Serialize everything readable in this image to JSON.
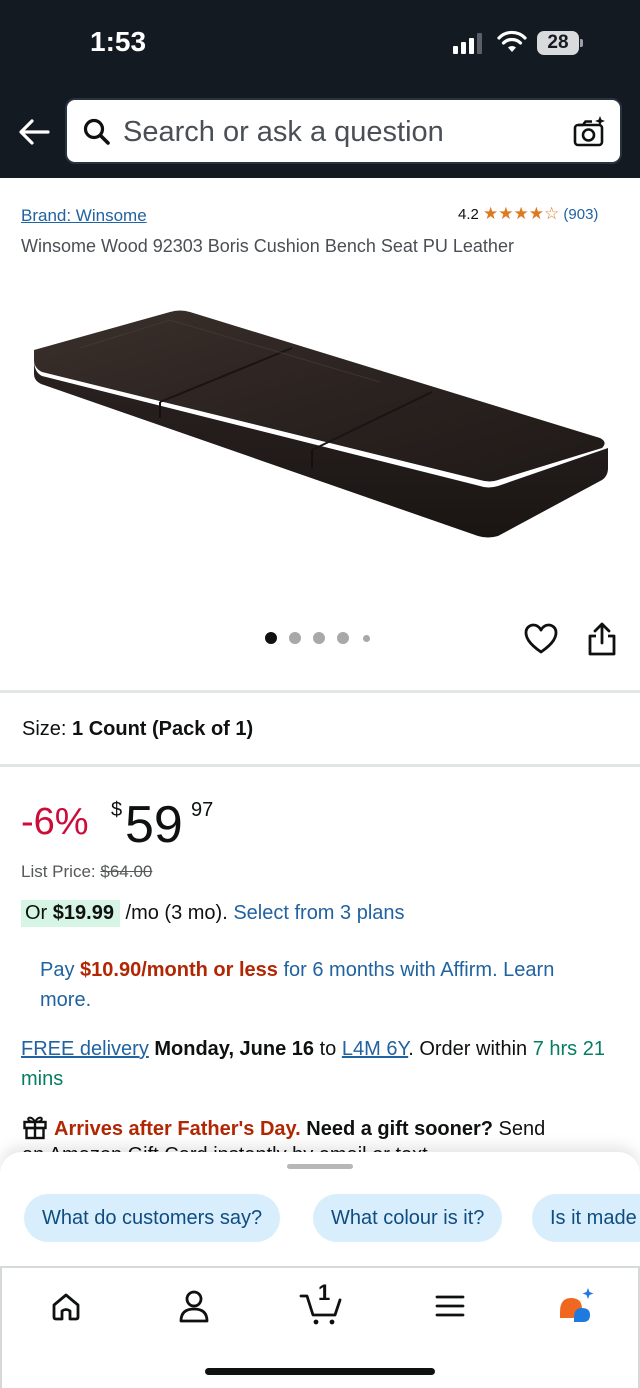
{
  "status": {
    "time": "1:53",
    "battery": "28"
  },
  "search": {
    "placeholder": "Search or ask a question"
  },
  "product": {
    "brand": "Brand: Winsome",
    "rating": "4.2",
    "stars": "★★★★☆",
    "review_count": "(903)",
    "title": "Winsome Wood 92303 Boris Cushion Bench Seat PU Leather",
    "image_count": 5,
    "active_image": 1
  },
  "size": {
    "label": "Size:",
    "value": "1 Count (Pack of 1)"
  },
  "pricing": {
    "discount": "-6%",
    "currency": "$",
    "whole": "59",
    "fraction": "97",
    "list_label": "List Price:",
    "list_price": "$64.00",
    "plan_prefix": "Or",
    "plan_amount": "$19.99",
    "plan_term": "/mo (3 mo).",
    "plan_link": "Select from 3 plans"
  },
  "affirm": {
    "prefix": "Pay",
    "amount": "$10.90/month or less",
    "suffix": "for 6 months with Affirm. Learn more."
  },
  "delivery": {
    "free_link": "FREE delivery",
    "date": "Monday, June 16",
    "to": "to",
    "postal": "L4M 6Y",
    "order_within": ". Order within",
    "time_left": "7 hrs 21 mins"
  },
  "gift": {
    "warning": "Arrives after Father's Day.",
    "question": "Need a gift sooner?",
    "send": "Send",
    "line2": "an Amazon Gift Card instantly by email or text."
  },
  "suggestions": [
    "What do customers say?",
    "What colour is it?",
    "Is it made of real leather?"
  ],
  "tabs": {
    "cart_count": "1"
  },
  "colors": {
    "header": "#131a22",
    "link": "#2162a1",
    "deal_red": "#cc0c39",
    "star": "#de7921",
    "chip": "#d9eefc"
  }
}
